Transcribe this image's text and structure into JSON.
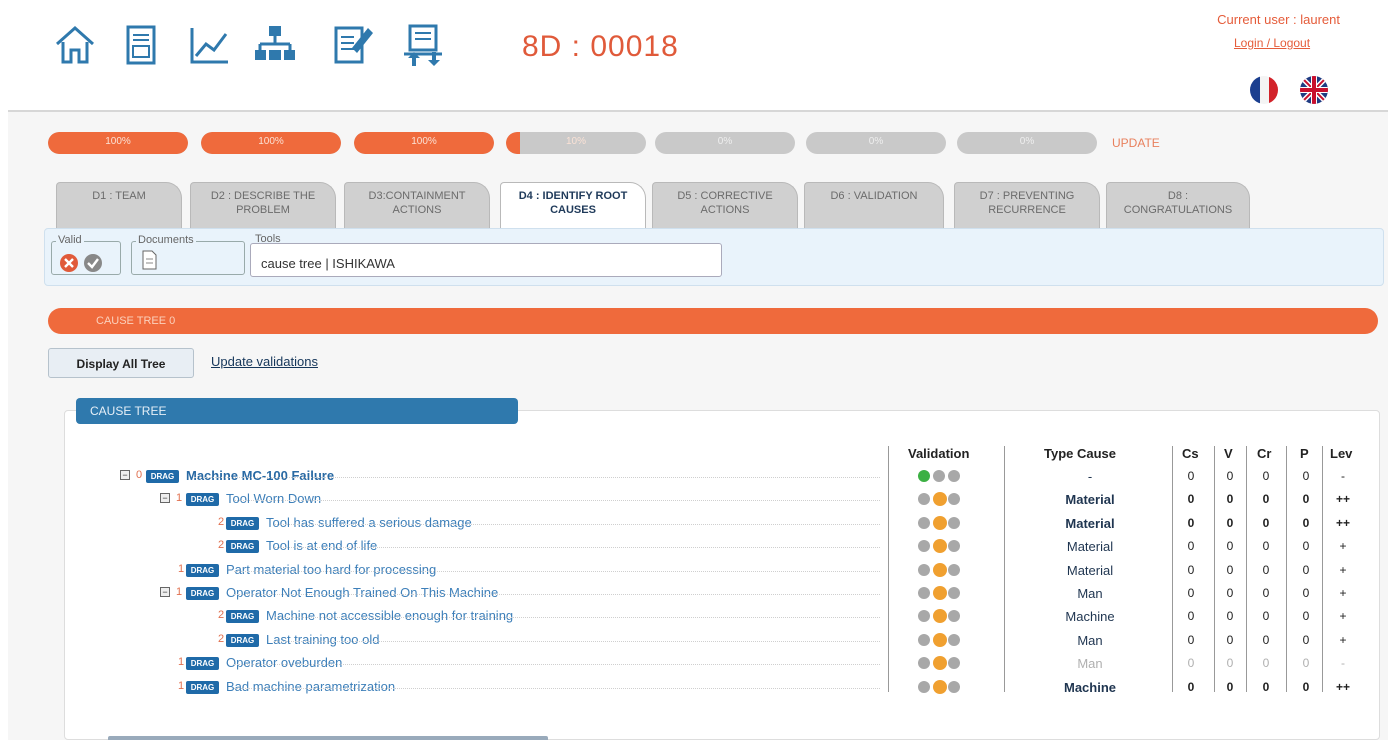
{
  "header": {
    "nav": [
      {
        "name": "home-icon"
      },
      {
        "name": "report-icon"
      },
      {
        "name": "chart-icon"
      },
      {
        "name": "organization-icon"
      },
      {
        "name": "edit-document-icon"
      },
      {
        "name": "transfer-icon"
      }
    ],
    "title": "8D : 00018",
    "current_user": "Current user : laurent",
    "login_logout": "Login / Logout",
    "flags": [
      "french-flag-icon",
      "english-flag-icon"
    ]
  },
  "progress": [
    {
      "label": "100%",
      "value": 100
    },
    {
      "label": "100%",
      "value": 100
    },
    {
      "label": "100%",
      "value": 100
    },
    {
      "label": "10%",
      "value": 10
    },
    {
      "label": "0%",
      "value": 0
    },
    {
      "label": "0%",
      "value": 0
    },
    {
      "label": "0%",
      "value": 0
    }
  ],
  "update_label": "UPDATE",
  "tabs": [
    {
      "line1": "D1 : TEAM",
      "line2": ""
    },
    {
      "line1": "D2 : DESCRIBE THE",
      "line2": "PROBLEM"
    },
    {
      "line1": "D3:CONTAINMENT",
      "line2": "ACTIONS"
    },
    {
      "line1": "D4 : IDENTIFY ROOT",
      "line2": "CAUSES"
    },
    {
      "line1": "D5 : CORRECTIVE",
      "line2": "ACTIONS"
    },
    {
      "line1": "D6 : VALIDATION",
      "line2": ""
    },
    {
      "line1": "D7 : PREVENTING",
      "line2": "RECURRENCE"
    },
    {
      "line1": "D8 :",
      "line2": "CONGRATULATIONS"
    }
  ],
  "toolsbar": {
    "valid_label": "Valid",
    "documents_label": "Documents",
    "tools_label": "Tools",
    "tools_value": "cause tree | ISHIKAWA"
  },
  "cause_bar": "CAUSE TREE  0",
  "display_all_tree": "Display All Tree",
  "update_validations": "Update validations",
  "tree_title": "CAUSE TREE",
  "columns": {
    "validation": "Validation",
    "type_cause": "Type Cause",
    "cs": "Cs",
    "v": "V",
    "cr": "Cr",
    "p": "P",
    "lev": "Lev"
  },
  "colors": {
    "accent_orange": "#ef6a3c",
    "tree_blue": "#2f79ad",
    "green_dot": "#3cb043",
    "orange_dot": "#f0a030",
    "gray_dot": "#a8a8a8"
  },
  "rows": [
    {
      "level": "0",
      "name": "Machine MC-100 Failure",
      "toggle": "−",
      "validation": [
        "green",
        "gray",
        "gray"
      ],
      "type": "-",
      "cs": "0",
      "v": "0",
      "cr": "0",
      "p": "0",
      "lev": "-",
      "bold": false,
      "faded": false
    },
    {
      "level": "1",
      "name": "Tool Worn Down",
      "toggle": "−",
      "validation": [
        "gray",
        "orange",
        "gray"
      ],
      "type": "Material",
      "cs": "0",
      "v": "0",
      "cr": "0",
      "p": "0",
      "lev": "++",
      "bold": true,
      "faded": false
    },
    {
      "level": "2",
      "name": "Tool has suffered a serious damage",
      "toggle": "",
      "validation": [
        "gray",
        "orange",
        "gray"
      ],
      "type": "Material",
      "cs": "0",
      "v": "0",
      "cr": "0",
      "p": "0",
      "lev": "++",
      "bold": true,
      "faded": false
    },
    {
      "level": "2",
      "name": "Tool is at end of life",
      "toggle": "",
      "validation": [
        "gray",
        "orange",
        "gray"
      ],
      "type": "Material",
      "cs": "0",
      "v": "0",
      "cr": "0",
      "p": "0",
      "lev": "+",
      "bold": false,
      "faded": false
    },
    {
      "level": "1",
      "name": "Part material too hard for processing",
      "toggle": "",
      "validation": [
        "gray",
        "orange",
        "gray"
      ],
      "type": "Material",
      "cs": "0",
      "v": "0",
      "cr": "0",
      "p": "0",
      "lev": "+",
      "bold": false,
      "faded": false
    },
    {
      "level": "1",
      "name": "Operator Not Enough Trained On This Machine",
      "toggle": "−",
      "validation": [
        "gray",
        "orange",
        "gray"
      ],
      "type": "Man",
      "cs": "0",
      "v": "0",
      "cr": "0",
      "p": "0",
      "lev": "+",
      "bold": false,
      "faded": false
    },
    {
      "level": "2",
      "name": "Machine not accessible enough for training",
      "toggle": "",
      "validation": [
        "gray",
        "orange",
        "gray"
      ],
      "type": "Machine",
      "cs": "0",
      "v": "0",
      "cr": "0",
      "p": "0",
      "lev": "+",
      "bold": false,
      "faded": false
    },
    {
      "level": "2",
      "name": "Last training too old",
      "toggle": "",
      "validation": [
        "gray",
        "orange",
        "gray"
      ],
      "type": "Man",
      "cs": "0",
      "v": "0",
      "cr": "0",
      "p": "0",
      "lev": "+",
      "bold": false,
      "faded": false
    },
    {
      "level": "1",
      "name": "Operator oveburden",
      "toggle": "",
      "validation": [
        "gray",
        "orange",
        "gray"
      ],
      "type": "Man",
      "cs": "0",
      "v": "0",
      "cr": "0",
      "p": "0",
      "lev": "-",
      "bold": false,
      "faded": true
    },
    {
      "level": "1",
      "name": "Bad machine parametrization",
      "toggle": "",
      "validation": [
        "gray",
        "orange",
        "gray"
      ],
      "type": "Machine",
      "cs": "0",
      "v": "0",
      "cr": "0",
      "p": "0",
      "lev": "++",
      "bold": true,
      "faded": false
    }
  ],
  "drag_label": "DRAG"
}
